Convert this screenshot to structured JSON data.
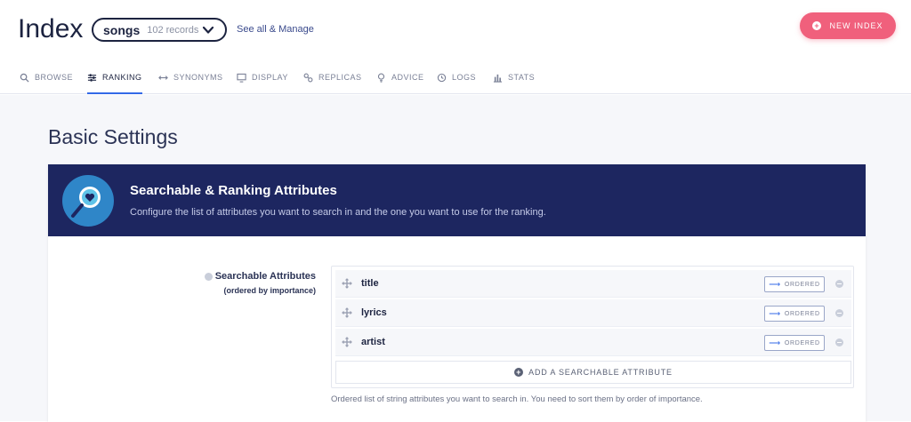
{
  "header": {
    "title": "Index",
    "index_name": "songs",
    "index_count": "102 records",
    "see_all": "See all & Manage",
    "new_index": "NEW INDEX",
    "new_index_color": "#f0607c",
    "brand_color": "#1c2340"
  },
  "tabs": [
    {
      "label": "BROWSE",
      "icon": "search-icon"
    },
    {
      "label": "RANKING",
      "icon": "sliders-icon",
      "active": true
    },
    {
      "label": "SYNONYMS",
      "icon": "arrows-horizontal-icon"
    },
    {
      "label": "DISPLAY",
      "icon": "monitor-icon"
    },
    {
      "label": "REPLICAS",
      "icon": "link-icon"
    },
    {
      "label": "ADVICE",
      "icon": "lightbulb-icon"
    },
    {
      "label": "LOGS",
      "icon": "clock-icon"
    },
    {
      "label": "STATS",
      "icon": "bar-chart-icon"
    }
  ],
  "main": {
    "section_title": "Basic Settings",
    "banner": {
      "title": "Searchable & Ranking Attributes",
      "description": "Configure the list of attributes you want to search in and the one you want to use for the ranking.",
      "icon": "magnifier-heart-icon",
      "background": "#1d2660"
    },
    "searchable": {
      "label": "Searchable Attributes",
      "sublabel": "(ordered by importance)",
      "attributes": [
        {
          "name": "title",
          "mode": "ORDERED"
        },
        {
          "name": "lyrics",
          "mode": "ORDERED"
        },
        {
          "name": "artist",
          "mode": "ORDERED"
        }
      ],
      "add_label": "ADD A SEARCHABLE ATTRIBUTE",
      "help": "Ordered list of string attributes you want to search in. You need to sort them by order of importance."
    }
  }
}
